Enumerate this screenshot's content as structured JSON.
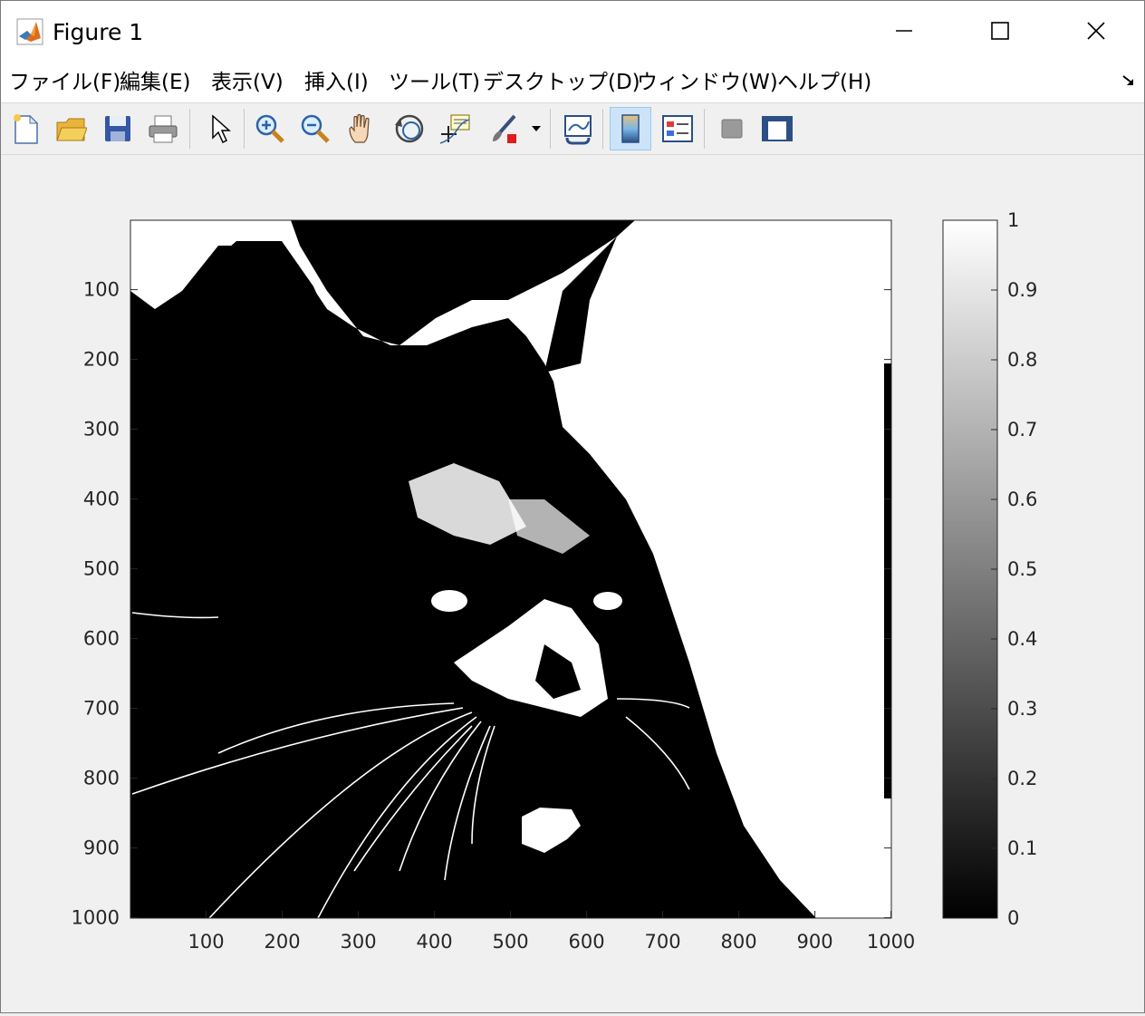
{
  "window": {
    "title": "Figure 1"
  },
  "menu": {
    "items": [
      {
        "label": "ファイル(F)",
        "icon": "none"
      },
      {
        "label": "編集(E)"
      },
      {
        "label": "表示(V)"
      },
      {
        "label": "挿入(I)"
      },
      {
        "label": "ツール(T)"
      },
      {
        "label": "デスクトップ(D)"
      },
      {
        "label": "ウィンドウ(W)"
      },
      {
        "label": "ヘルプ(H)"
      }
    ]
  },
  "toolbar": {
    "buttons": [
      {
        "name": "new-figure-icon"
      },
      {
        "name": "open-file-icon"
      },
      {
        "name": "save-icon"
      },
      {
        "name": "print-icon"
      },
      {
        "name": "edit-plot-arrow-icon"
      },
      {
        "name": "zoom-in-icon"
      },
      {
        "name": "zoom-out-icon"
      },
      {
        "name": "pan-hand-icon"
      },
      {
        "name": "rotate-3d-icon"
      },
      {
        "name": "data-cursor-icon"
      },
      {
        "name": "brush-icon"
      },
      {
        "name": "link-plot-icon"
      },
      {
        "name": "colorbar-icon",
        "active": true
      },
      {
        "name": "legend-icon"
      },
      {
        "name": "hide-plot-tools-icon"
      },
      {
        "name": "show-plot-tools-icon"
      }
    ]
  },
  "chart_data": {
    "type": "heatmap",
    "description_image": "binarized cat photograph (black and white)",
    "colormap": "gray",
    "x_ticks": [
      "100",
      "200",
      "300",
      "400",
      "500",
      "600",
      "700",
      "800",
      "900",
      "1000"
    ],
    "y_ticks": [
      "100",
      "200",
      "300",
      "400",
      "500",
      "600",
      "700",
      "800",
      "900",
      "1000"
    ],
    "xlim": [
      0.5,
      1000.5
    ],
    "ylim": [
      0.5,
      1000.5
    ],
    "colorbar": {
      "ticks": [
        "0",
        "0.1",
        "0.2",
        "0.3",
        "0.4",
        "0.5",
        "0.6",
        "0.7",
        "0.8",
        "0.9",
        "1"
      ],
      "range": [
        0,
        1
      ]
    }
  }
}
